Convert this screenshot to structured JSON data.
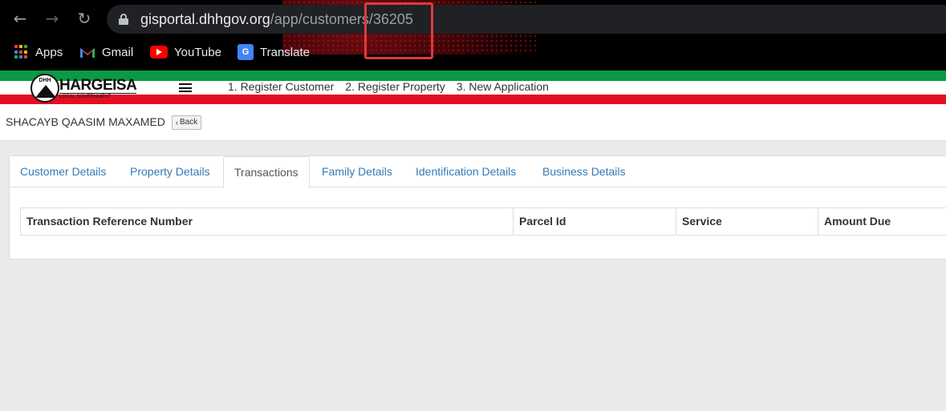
{
  "browser": {
    "url_host": "gisportal.dhhgov.org",
    "url_path": "/app/customers/36205",
    "bookmarks": [
      {
        "label": "Apps",
        "icon": "apps-grid-icon"
      },
      {
        "label": "Gmail",
        "icon": "gmail-icon"
      },
      {
        "label": "YouTube",
        "icon": "youtube-icon"
      },
      {
        "label": "Translate",
        "icon": "google-translate-icon"
      }
    ]
  },
  "app": {
    "logo_title": "HARGEISA",
    "logo_subtitle": "LOCAL GOVERNMENT",
    "logo_badge": "DHH",
    "menu": [
      {
        "label": "1. Register Customer"
      },
      {
        "label": "2. Register Property"
      },
      {
        "label": "3. New Application"
      }
    ]
  },
  "customer": {
    "name": "SHACAYB QAASIM MAXAMED",
    "back_label": "Back"
  },
  "tabs": [
    {
      "label": "Customer Details",
      "active": false
    },
    {
      "label": "Property Details",
      "active": false
    },
    {
      "label": "Transactions",
      "active": true
    },
    {
      "label": "Family Details",
      "active": false
    },
    {
      "label": "Identification Details",
      "active": false
    },
    {
      "label": "Business Details",
      "active": false
    }
  ],
  "transactions_table": {
    "columns": [
      "Transaction Reference Number",
      "Parcel Id",
      "Service",
      "Amount Due"
    ],
    "rows": []
  },
  "colors": {
    "flag_green": "#0a9a45",
    "flag_red": "#e30f22",
    "link_blue": "#337ab7",
    "highlight_red": "#e03a3a"
  }
}
